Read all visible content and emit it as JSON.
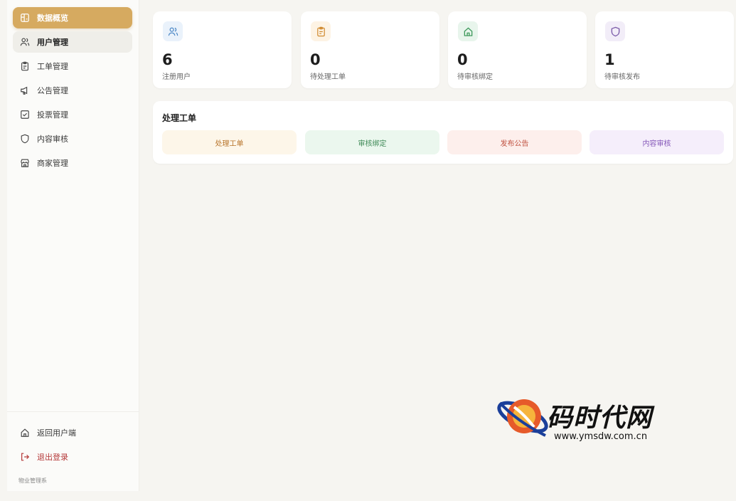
{
  "sidebar": {
    "items": [
      {
        "label": "数据概览",
        "icon": "dashboard-icon"
      },
      {
        "label": "用户管理",
        "icon": "users-icon"
      },
      {
        "label": "工单管理",
        "icon": "clipboard-icon"
      },
      {
        "label": "公告管理",
        "icon": "megaphone-icon"
      },
      {
        "label": "投票管理",
        "icon": "checkbox-icon"
      },
      {
        "label": "内容审核",
        "icon": "shield-icon"
      },
      {
        "label": "商家管理",
        "icon": "store-icon"
      }
    ],
    "bottom": [
      {
        "label": "返回用户端",
        "icon": "home-icon"
      },
      {
        "label": "退出登录",
        "icon": "logout-icon"
      }
    ],
    "footer_note": "物业管理系"
  },
  "stats": [
    {
      "value": "6",
      "label": "注册用户",
      "icon": "users-icon",
      "color": "#4a86c5",
      "bg": "#eaf2fb"
    },
    {
      "value": "0",
      "label": "待处理工单",
      "icon": "clipboard-icon",
      "color": "#d08a2f",
      "bg": "#fdf3e4"
    },
    {
      "value": "0",
      "label": "待审核绑定",
      "icon": "home-icon",
      "color": "#3f9a5d",
      "bg": "#e8f5ec"
    },
    {
      "value": "1",
      "label": "待审核发布",
      "icon": "shield-icon",
      "color": "#7a5aa8",
      "bg": "#f2edf8"
    }
  ],
  "panel": {
    "title": "处理工单",
    "actions": [
      {
        "label": "处理工单",
        "color": "#b8742a",
        "bg": "#fdf6e9"
      },
      {
        "label": "审核绑定",
        "color": "#3f8a57",
        "bg": "#ebf7ee"
      },
      {
        "label": "发布公告",
        "color": "#c0503f",
        "bg": "#fdefec"
      },
      {
        "label": "内容审核",
        "color": "#8456b8",
        "bg": "#f5eefb"
      }
    ]
  },
  "watermark": {
    "title": "码时代网",
    "url": "www.ymsdw.com.cn"
  }
}
